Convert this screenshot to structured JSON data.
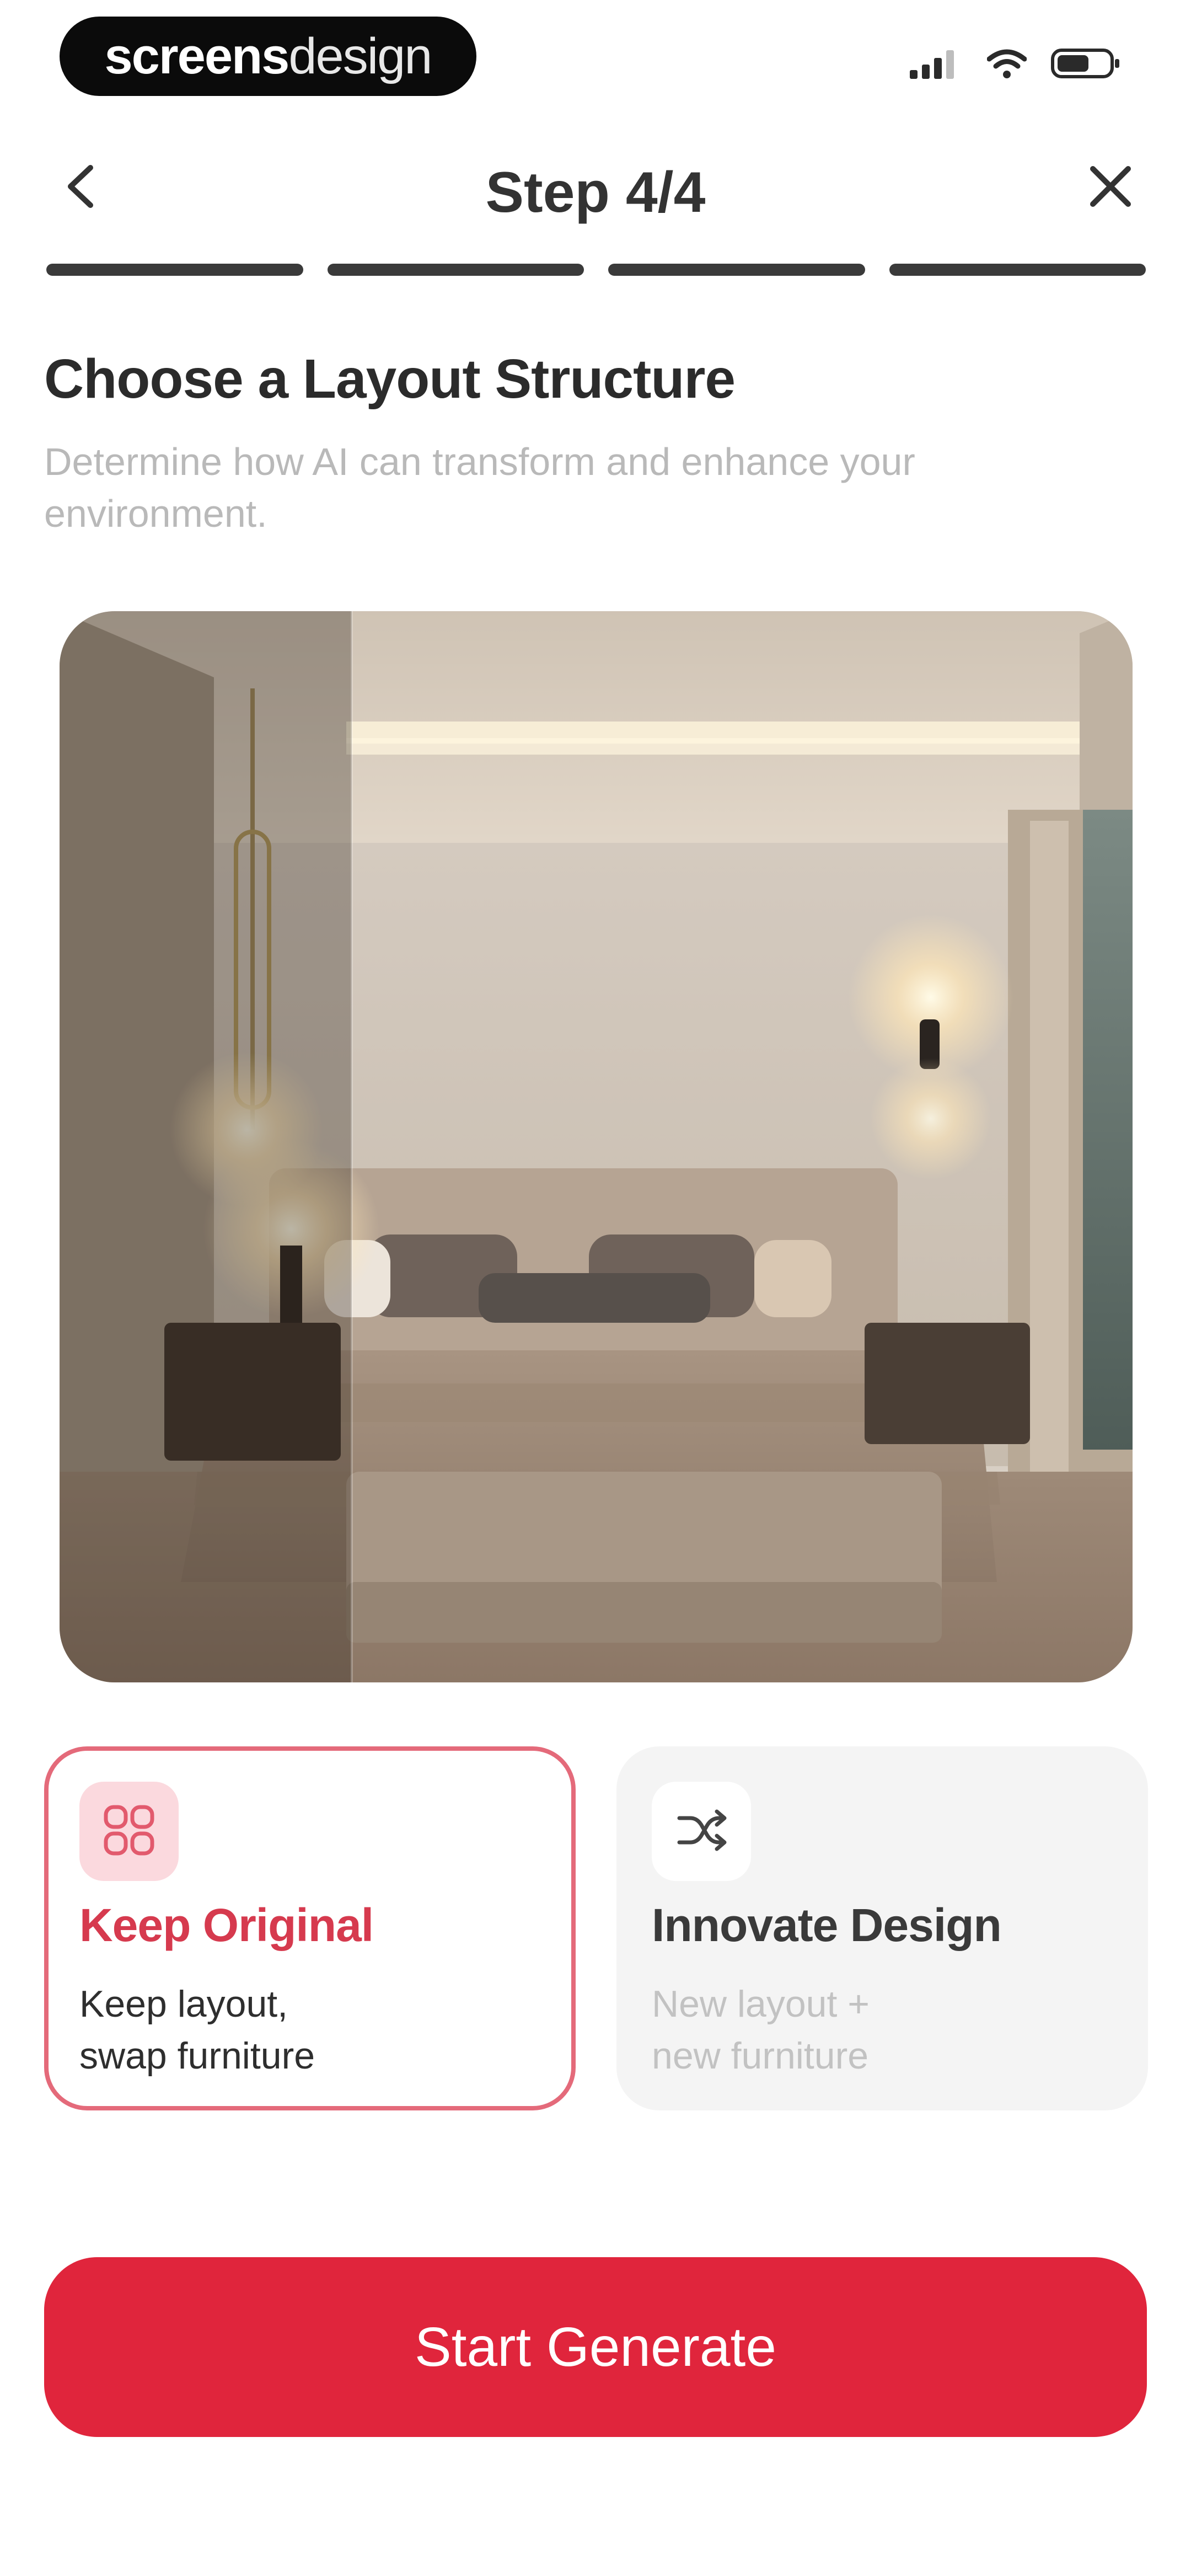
{
  "status_bar": {
    "brand_bold": "screens",
    "brand_light": "design",
    "signal_icon": "signal-icon",
    "wifi_icon": "wifi-icon",
    "battery_icon": "battery-icon"
  },
  "nav": {
    "title": "Step 4/4",
    "back_icon": "chevron-left-icon",
    "close_icon": "close-icon"
  },
  "progress": {
    "total_steps": 4,
    "current_step": 4
  },
  "content": {
    "heading": "Choose a Layout Structure",
    "subtext": "Determine how AI can transform and enhance your environment."
  },
  "options": [
    {
      "title": "Keep Original",
      "desc_line1": "Keep layout,",
      "desc_line2": "swap furniture",
      "icon": "grid-icon",
      "selected": true
    },
    {
      "title": "Innovate Design",
      "desc_line1": "New layout +",
      "desc_line2": "new furniture",
      "icon": "shuffle-icon",
      "selected": false
    }
  ],
  "cta": {
    "label": "Start Generate"
  },
  "colors": {
    "accent": "#e0253c",
    "selected_border": "#e46a7a",
    "selected_title": "#d63a4e",
    "icon_bg_selected": "#fbd9de"
  }
}
